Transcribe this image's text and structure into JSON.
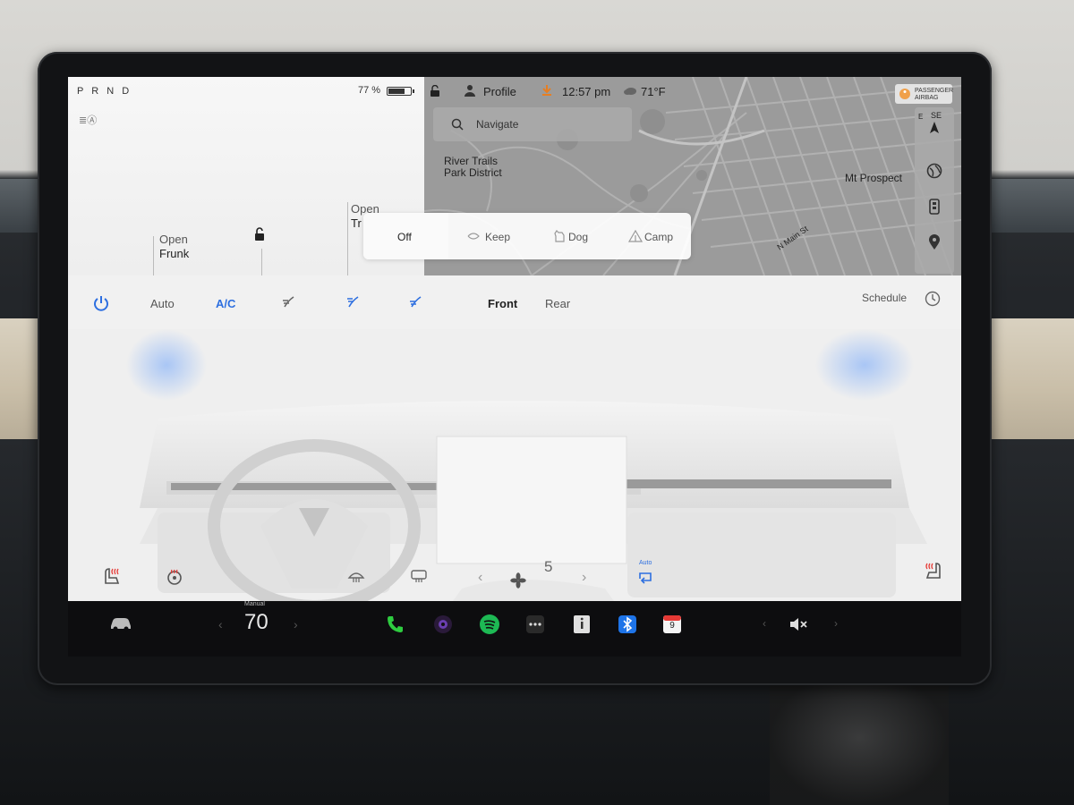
{
  "car": {
    "gear": "P R N D",
    "battery_text": "77 %",
    "battery_level": 0.77,
    "frunk_open": "Open",
    "frunk_name": "Frunk",
    "trunk_open": "Open",
    "trunk_name": "Tr"
  },
  "status": {
    "profile": "Profile",
    "time": "12:57 pm",
    "temperature": "71°F",
    "airbag_line1": "PASSENGER",
    "airbag_line2": "AIRBAG"
  },
  "map": {
    "search_placeholder": "Navigate",
    "label_park": "River Trails",
    "label_park2": "Park District",
    "label_city": "Mt Prospect",
    "label_street": "N Main St",
    "compass_e": "E",
    "compass_se": "SE"
  },
  "occupant_modes": {
    "off": "Off",
    "keep": "Keep",
    "dog": "Dog",
    "camp": "Camp"
  },
  "climate": {
    "auto": "Auto",
    "ac": "A/C",
    "front": "Front",
    "rear": "Rear",
    "schedule": "Schedule",
    "fan_speed": "5",
    "recirc_label": "Auto"
  },
  "bottom": {
    "speed_mode": "Manual",
    "speed_value": "70",
    "calendar_day": "9"
  },
  "colors": {
    "accent": "#2d6fe0",
    "phone": "#2ecc40",
    "spotify": "#1db954",
    "bluetooth": "#1e74e8",
    "calendar": "#e53935"
  }
}
